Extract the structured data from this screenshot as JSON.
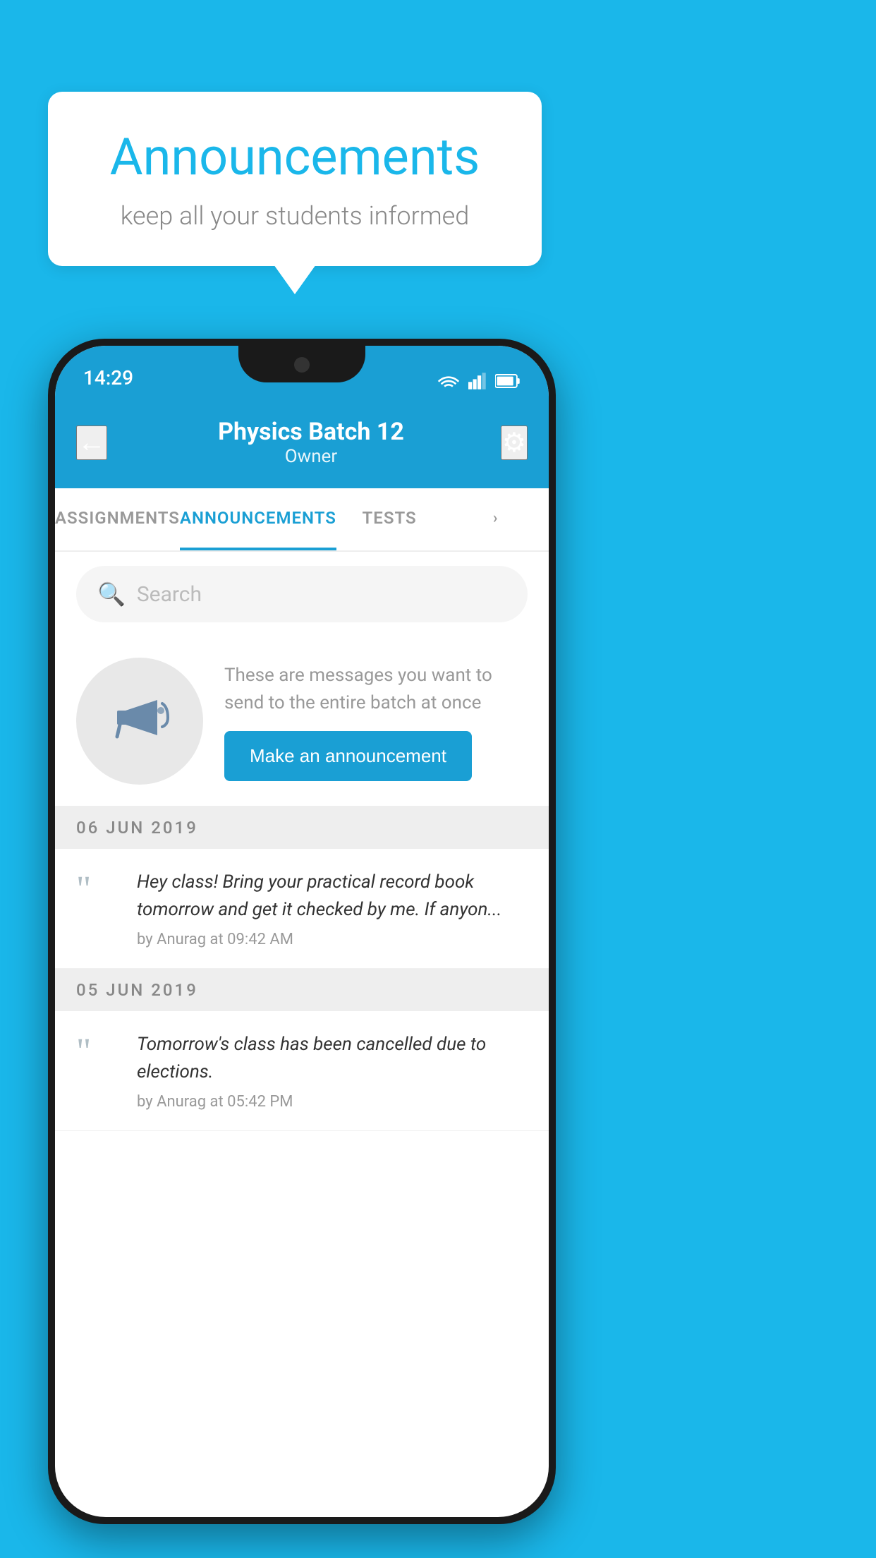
{
  "page": {
    "bg_color": "#1ab7ea"
  },
  "bubble": {
    "title": "Announcements",
    "subtitle": "keep all your students informed"
  },
  "phone": {
    "status_bar": {
      "time": "14:29"
    },
    "app_bar": {
      "title": "Physics Batch 12",
      "subtitle": "Owner",
      "back_label": "←",
      "gear_label": "⚙"
    },
    "tabs": [
      {
        "label": "ASSIGNMENTS",
        "active": false
      },
      {
        "label": "ANNOUNCEMENTS",
        "active": true
      },
      {
        "label": "TESTS",
        "active": false
      },
      {
        "label": "›",
        "active": false
      }
    ],
    "search": {
      "placeholder": "Search"
    },
    "promo": {
      "description": "These are messages you want to send to the entire batch at once",
      "button_label": "Make an announcement"
    },
    "announcements": [
      {
        "date": "06  JUN  2019",
        "text": "Hey class! Bring your practical record book tomorrow and get it checked by me. If anyon...",
        "meta": "by Anurag at 09:42 AM"
      },
      {
        "date": "05  JUN  2019",
        "text": "Tomorrow's class has been cancelled due to elections.",
        "meta": "by Anurag at 05:42 PM"
      }
    ]
  }
}
